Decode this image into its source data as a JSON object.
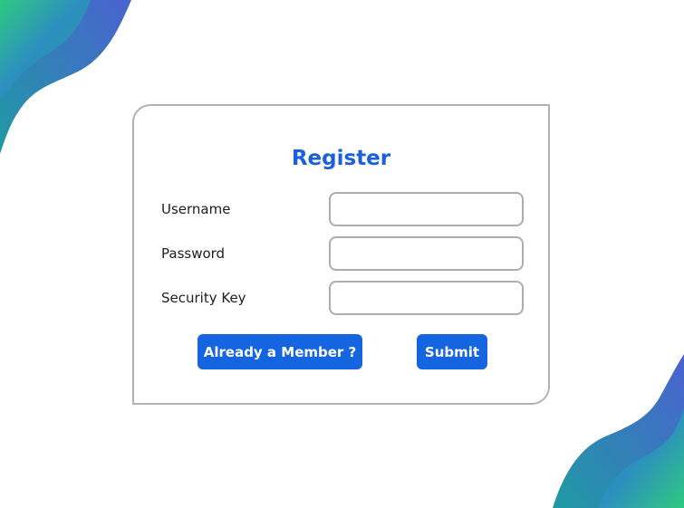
{
  "register": {
    "title": "Register",
    "fields": [
      {
        "label": "Username",
        "value": ""
      },
      {
        "label": "Password",
        "value": ""
      },
      {
        "label": "Security Key",
        "value": ""
      }
    ],
    "buttons": {
      "already_member_label": "Already a Member ?",
      "submit_label": "Submit"
    }
  },
  "colors": {
    "accent": "#1565e0",
    "title": "#1c60d9",
    "card_border": "#b3b3b3",
    "blob_green": "#2ec97f",
    "blob_teal": "#1f9aa3",
    "blob_blue": "#3a5fc8"
  }
}
